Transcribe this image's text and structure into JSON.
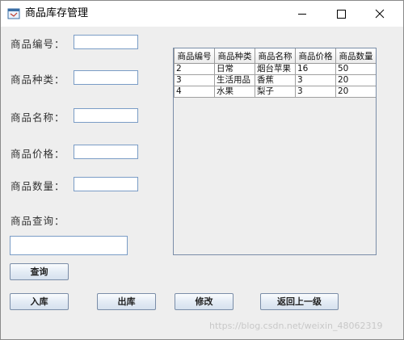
{
  "window": {
    "title": "商品库存管理"
  },
  "form": {
    "id_label": "商品编号：",
    "type_label": "商品种类：",
    "name_label": "商品名称：",
    "price_label": "商品价格：",
    "qty_label": "商品数量：",
    "query_label": "商品查询：",
    "id_value": "",
    "type_value": "",
    "name_value": "",
    "price_value": "",
    "qty_value": "",
    "query_value": ""
  },
  "buttons": {
    "query": "查询",
    "stock_in": "入库",
    "stock_out": "出库",
    "modify": "修改",
    "back": "返回上一级"
  },
  "table": {
    "columns": [
      "商品编号",
      "商品种类",
      "商品名称",
      "商品价格",
      "商品数量"
    ],
    "rows": [
      [
        "2",
        "日常",
        "烟台苹果",
        "16",
        "50"
      ],
      [
        "3",
        "生活用品",
        "香蕉",
        "3",
        "20"
      ],
      [
        "4",
        "水果",
        "梨子",
        "3",
        "20"
      ]
    ]
  },
  "watermark": "https://blog.csdn.net/weixin_48062319",
  "colors": {
    "window_bg": "#eeeeee",
    "field_border": "#7a9cc6",
    "button_border": "#7a8da8"
  },
  "icons": [
    "app-icon",
    "minimize-icon",
    "maximize-icon",
    "close-icon"
  ]
}
